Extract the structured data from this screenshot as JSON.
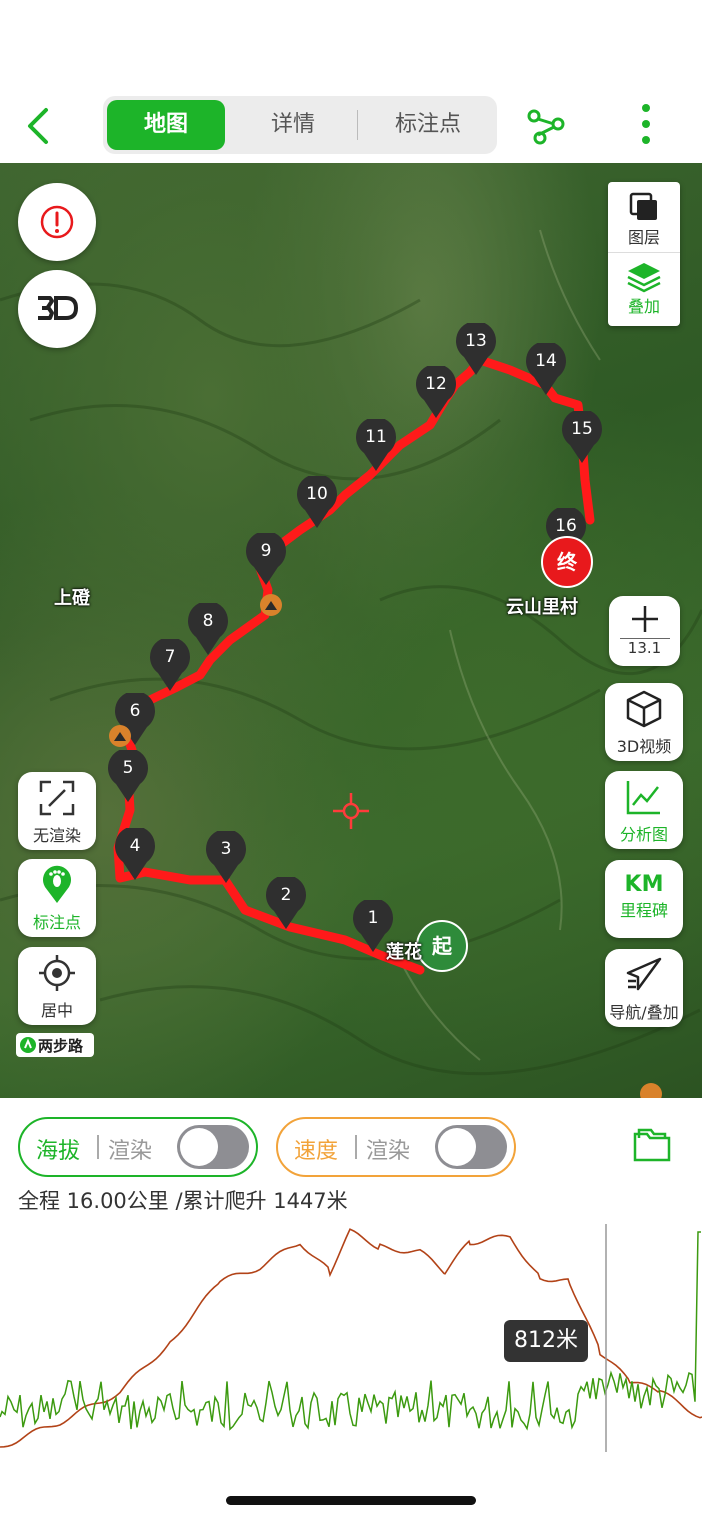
{
  "nav": {
    "tabs": [
      {
        "label": "地图",
        "active": true
      },
      {
        "label": "详情",
        "active": false
      },
      {
        "label": "标注点",
        "active": false
      }
    ]
  },
  "map": {
    "right_top": {
      "layers_label": "图层",
      "overlay_label": "叠加"
    },
    "zoom": {
      "level": "13.1"
    },
    "right_buttons": {
      "video_3d": "3D视频",
      "analysis": "分析图",
      "km_icon": "KM",
      "milestone": "里程碑",
      "navigate": "导航/叠加"
    },
    "left_buttons": {
      "no_render": "无渲染",
      "waypoints": "标注点",
      "center": "居中"
    },
    "brand": "两步路",
    "markers": [
      "1",
      "2",
      "3",
      "4",
      "5",
      "6",
      "7",
      "8",
      "9",
      "10",
      "11",
      "12",
      "13",
      "14",
      "15",
      "16"
    ],
    "start_label": "起",
    "end_label": "终",
    "place_labels": {
      "west": "上磴",
      "end_village": "云山里村",
      "start_village": "莲花"
    }
  },
  "controls": {
    "altitude": {
      "title": "海拔",
      "render": "渲染",
      "on": false
    },
    "speed": {
      "title": "速度",
      "render": "渲染",
      "on": false
    }
  },
  "summary": "全程 16.00公里 /累计爬升 1447米",
  "chart": {
    "tooltip": "812米",
    "colors": {
      "altitude": "#b24318",
      "speed": "#3c9a10"
    }
  },
  "colors": {
    "accent": "#1db429",
    "track": "#ff1a1a",
    "speed_accent": "#f2a33a"
  }
}
